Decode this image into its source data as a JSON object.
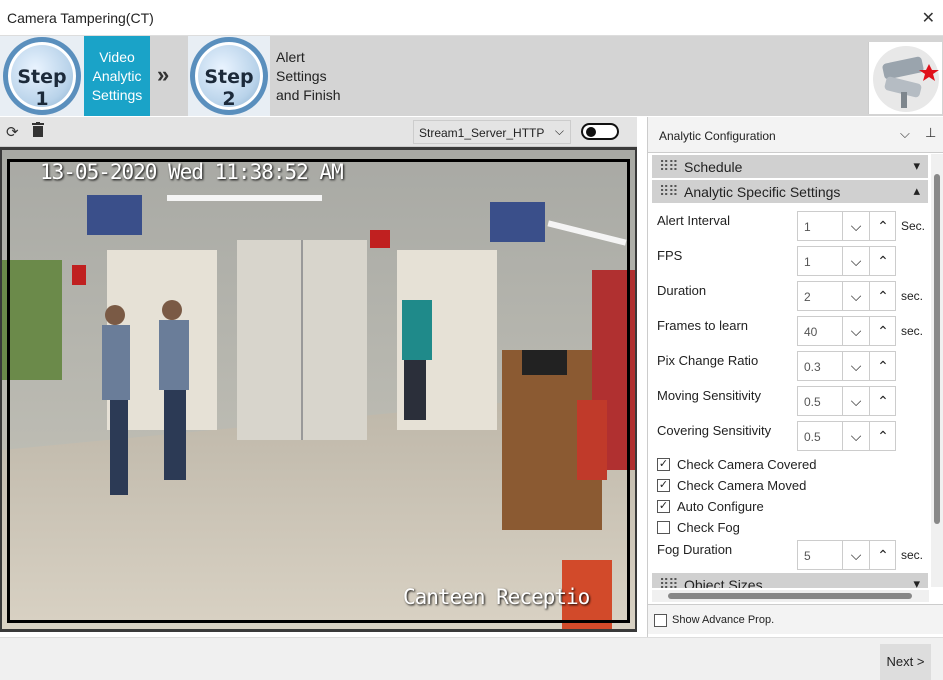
{
  "window": {
    "title": "Camera Tampering(CT)",
    "close_glyph": "✕"
  },
  "wizard": {
    "step1": {
      "badge": "Step 1",
      "label": "Video Analytic Settings",
      "active_color": "#1aa3c8"
    },
    "step2": {
      "badge": "Step 2",
      "label": "Alert Settings and Finish"
    },
    "separator_glyph": "»"
  },
  "video_toolbar": {
    "refresh_icon": "refresh-icon",
    "delete_icon": "trash-icon",
    "stream": "Stream1_Server_HTTP",
    "toggle_on": false
  },
  "video": {
    "osd_datetime": "13-05-2020 Wed 11:38:52 AM",
    "osd_camera_name": "Canteen Receptio"
  },
  "panel": {
    "title": "Analytic Configuration",
    "sections": {
      "schedule": "Schedule",
      "analytic_specific": "Analytic Specific Settings",
      "object_sizes": "Object Sizes"
    },
    "fields": [
      {
        "label": "Alert Interval",
        "value": "1",
        "unit": "Sec."
      },
      {
        "label": "FPS",
        "value": "1",
        "unit": ""
      },
      {
        "label": "Duration",
        "value": "2",
        "unit": "sec."
      },
      {
        "label": "Frames to learn",
        "value": "40",
        "unit": "sec."
      },
      {
        "label": "Pix Change Ratio",
        "value": "0.3",
        "unit": ""
      },
      {
        "label": "Moving Sensitivity",
        "value": "0.5",
        "unit": ""
      },
      {
        "label": "Covering Sensitivity",
        "value": "0.5",
        "unit": ""
      }
    ],
    "checkboxes": [
      {
        "label": "Check Camera Covered",
        "checked": true
      },
      {
        "label": "Check Camera Moved",
        "checked": true
      },
      {
        "label": "Auto Configure",
        "checked": true
      },
      {
        "label": "Check Fog",
        "checked": false
      }
    ],
    "fog_duration": {
      "label": "Fog Duration",
      "value": "5",
      "unit": "sec."
    },
    "show_advance": {
      "label": "Show Advance Prop.",
      "checked": false
    }
  },
  "footer": {
    "next_label": "Next >"
  }
}
